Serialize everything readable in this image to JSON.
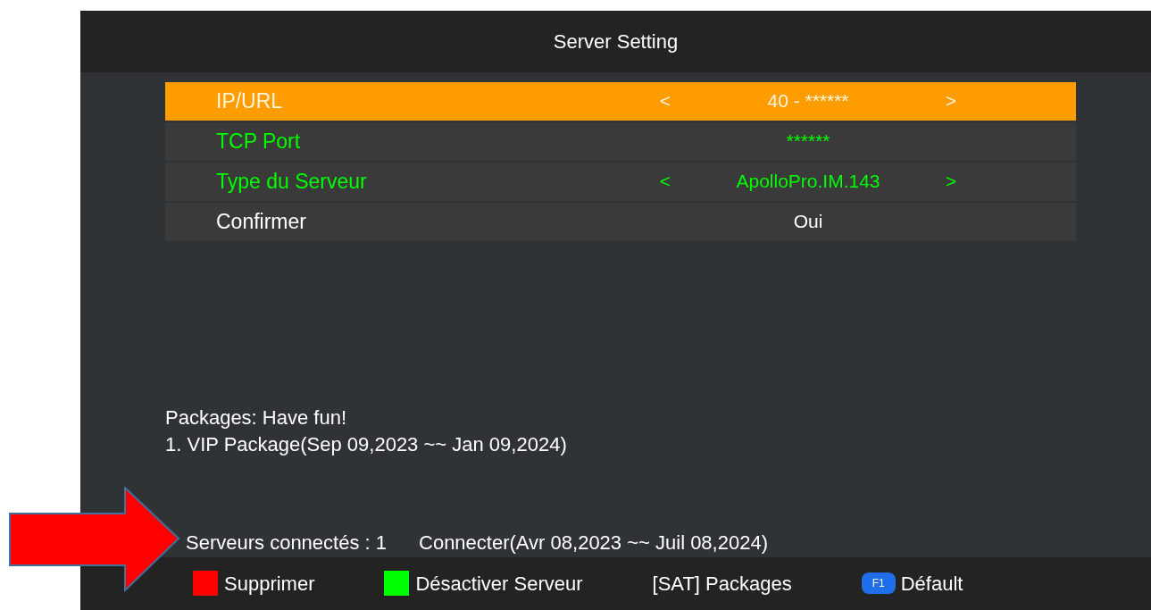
{
  "window": {
    "title": "Server Setting"
  },
  "settings": [
    {
      "label": "IP/URL",
      "value": "40 - ******",
      "arrows": true,
      "selected": true,
      "color": "#fff4dc"
    },
    {
      "label": "TCP Port",
      "value": "******",
      "arrows": false,
      "selected": false,
      "color": "#00ff00"
    },
    {
      "label": "Type du Serveur",
      "value": "ApolloPro.IM.143",
      "arrows": true,
      "selected": false,
      "color": "#00ff00"
    },
    {
      "label": "Confirmer",
      "value": "Oui",
      "arrows": false,
      "selected": false,
      "color": "#ffffff"
    }
  ],
  "arrow_left": "<",
  "arrow_right": ">",
  "packages": [
    "Packages: Have fun!",
    "1. VIP Package(Sep 09,2023 ~~ Jan 09,2024)"
  ],
  "status": {
    "servers": "Serveurs connectés : 1",
    "connection": "Connecter(Avr 08,2023 ~~ Juil 08,2024)"
  },
  "annotation": {
    "kind": "arrow"
  },
  "footer": [
    {
      "kind": "swatch",
      "color": "#ff0000",
      "label": "Supprimer"
    },
    {
      "kind": "swatch",
      "color": "#00ff00",
      "label": "Désactiver Serveur"
    },
    {
      "kind": "plain",
      "label": "[SAT] Packages"
    },
    {
      "kind": "key",
      "key": "F1",
      "label": "Défault"
    }
  ]
}
